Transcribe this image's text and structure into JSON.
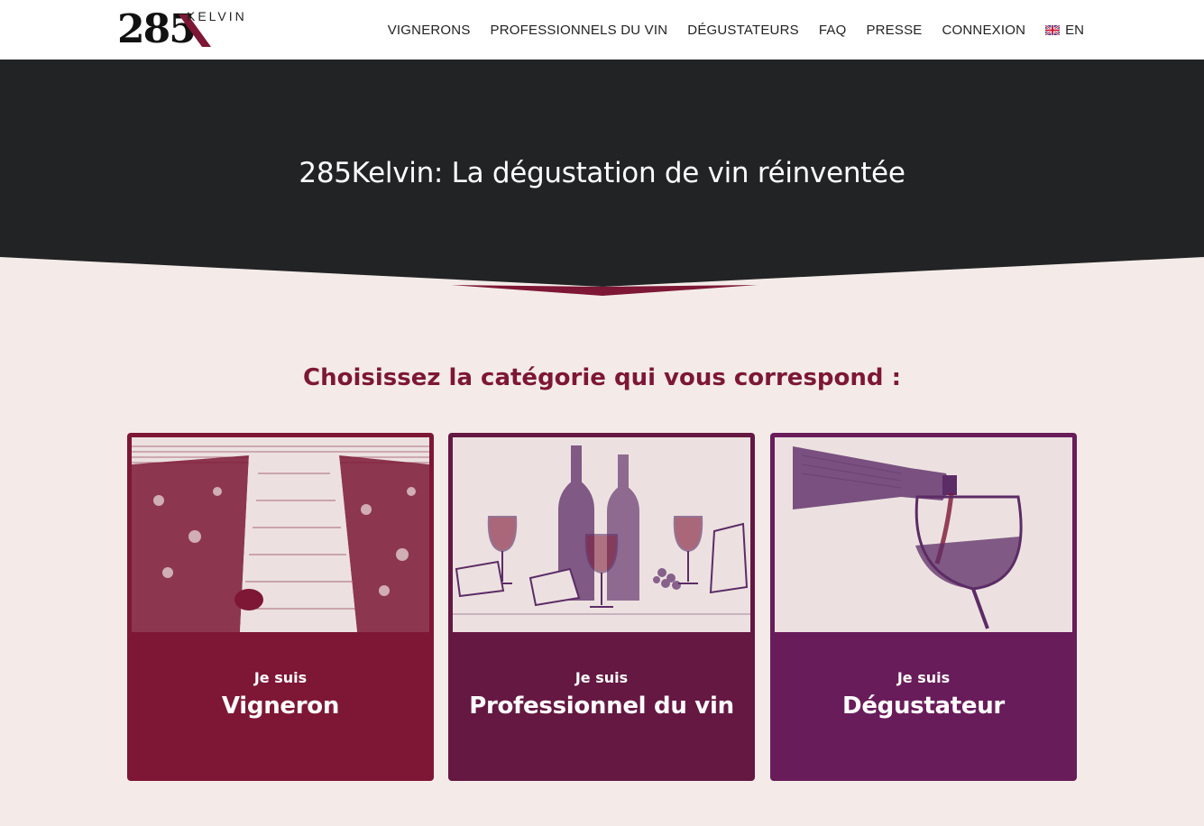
{
  "brand": {
    "number": "285",
    "word": "KELVIN"
  },
  "nav": {
    "items": [
      "VIGNERONS",
      "PROFESSIONNELS DU VIN",
      "DÉGUSTATEURS",
      "FAQ",
      "PRESSE",
      "CONNEXION"
    ],
    "language": "EN"
  },
  "hero": {
    "title": "285Kelvin: La dégustation de vin réinventée"
  },
  "section": {
    "title": "Choisissez la catégorie qui vous correspond :"
  },
  "cards": [
    {
      "pre": "Je suis",
      "name": "Vigneron",
      "color": "#7d1735"
    },
    {
      "pre": "Je suis",
      "name": "Professionnel du vin",
      "color": "#651842"
    },
    {
      "pre": "Je suis",
      "name": "Dégustateur",
      "color": "#691c5a"
    }
  ],
  "colors": {
    "dark": "#222325",
    "background": "#f4ebe8",
    "accent": "#7d1735",
    "plum": "#5c2c66"
  }
}
